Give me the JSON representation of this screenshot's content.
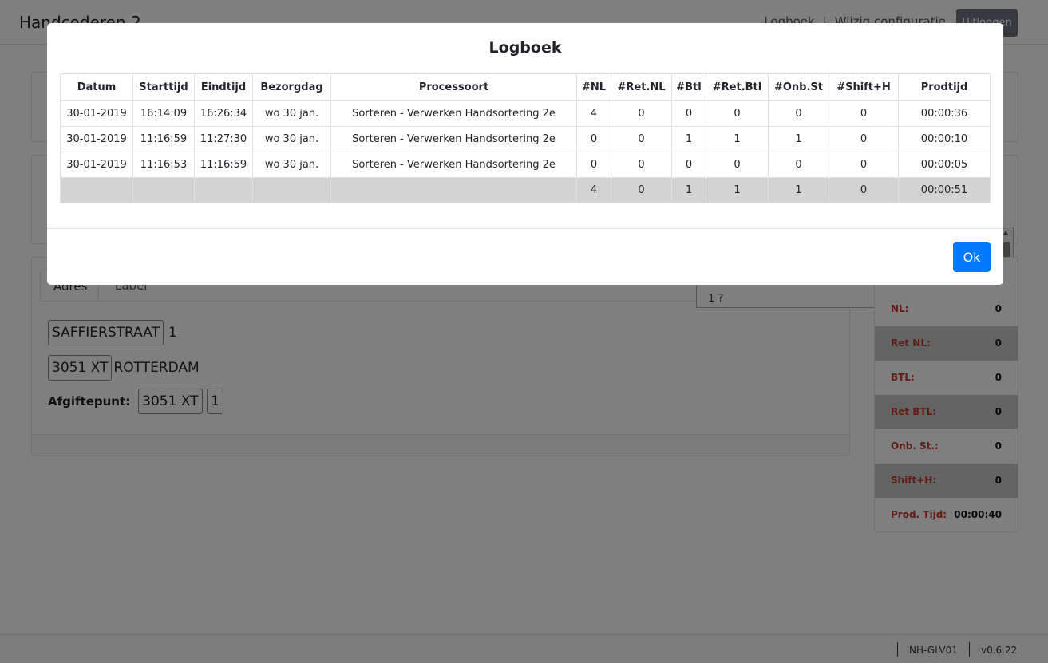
{
  "navbar": {
    "brand": "Handcoderen 2",
    "links": [
      "Logboek",
      "Wijzig configuratie"
    ],
    "separator": "|",
    "logout_label": "Uitloggen"
  },
  "address": {
    "tabs": [
      "Adres",
      "Label"
    ],
    "street": "SAFFIERSTRAAT",
    "house_number": "1",
    "postcode": "3051 XT",
    "city": "ROTTERDAM",
    "drop_point_label": "Afgiftepunt:",
    "drop_point_postcode": "3051 XT",
    "drop_point_number": "1"
  },
  "dropdown": {
    "visible_item": "1 ?"
  },
  "stats": [
    {
      "label": "NL:",
      "value": "0"
    },
    {
      "label": "Ret NL:",
      "value": "0"
    },
    {
      "label": "BTL:",
      "value": "0"
    },
    {
      "label": "Ret BTL:",
      "value": "0"
    },
    {
      "label": "Onb. St.:",
      "value": "0"
    },
    {
      "label": "Shift+H:",
      "value": "0"
    },
    {
      "label": "Prod. Tijd:",
      "value": "00:00:40"
    }
  ],
  "statusbar": {
    "station": "NH-GLV01",
    "version": "v0.6.22"
  },
  "modal": {
    "title": "Logboek",
    "ok_label": "Ok",
    "columns": [
      "Datum",
      "Starttijd",
      "Eindtijd",
      "Bezorgdag",
      "Processoort",
      "#NL",
      "#Ret.NL",
      "#Btl",
      "#Ret.Btl",
      "#Onb.St",
      "#Shift+H",
      "Prodtijd"
    ],
    "rows": [
      [
        "30-01-2019",
        "16:14:09",
        "16:26:34",
        "wo 30 jan.",
        "Sorteren - Verwerken Handsortering 2e",
        "4",
        "0",
        "0",
        "0",
        "0",
        "0",
        "00:00:36"
      ],
      [
        "30-01-2019",
        "11:16:59",
        "11:27:30",
        "wo 30 jan.",
        "Sorteren - Verwerken Handsortering 2e",
        "0",
        "0",
        "1",
        "1",
        "1",
        "0",
        "00:00:10"
      ],
      [
        "30-01-2019",
        "11:16:53",
        "11:16:59",
        "wo 30 jan.",
        "Sorteren - Verwerken Handsortering 2e",
        "0",
        "0",
        "0",
        "0",
        "0",
        "0",
        "00:00:05"
      ]
    ],
    "totals": [
      "",
      "",
      "",
      "",
      "",
      "4",
      "0",
      "1",
      "1",
      "1",
      "0",
      "00:00:51"
    ]
  }
}
